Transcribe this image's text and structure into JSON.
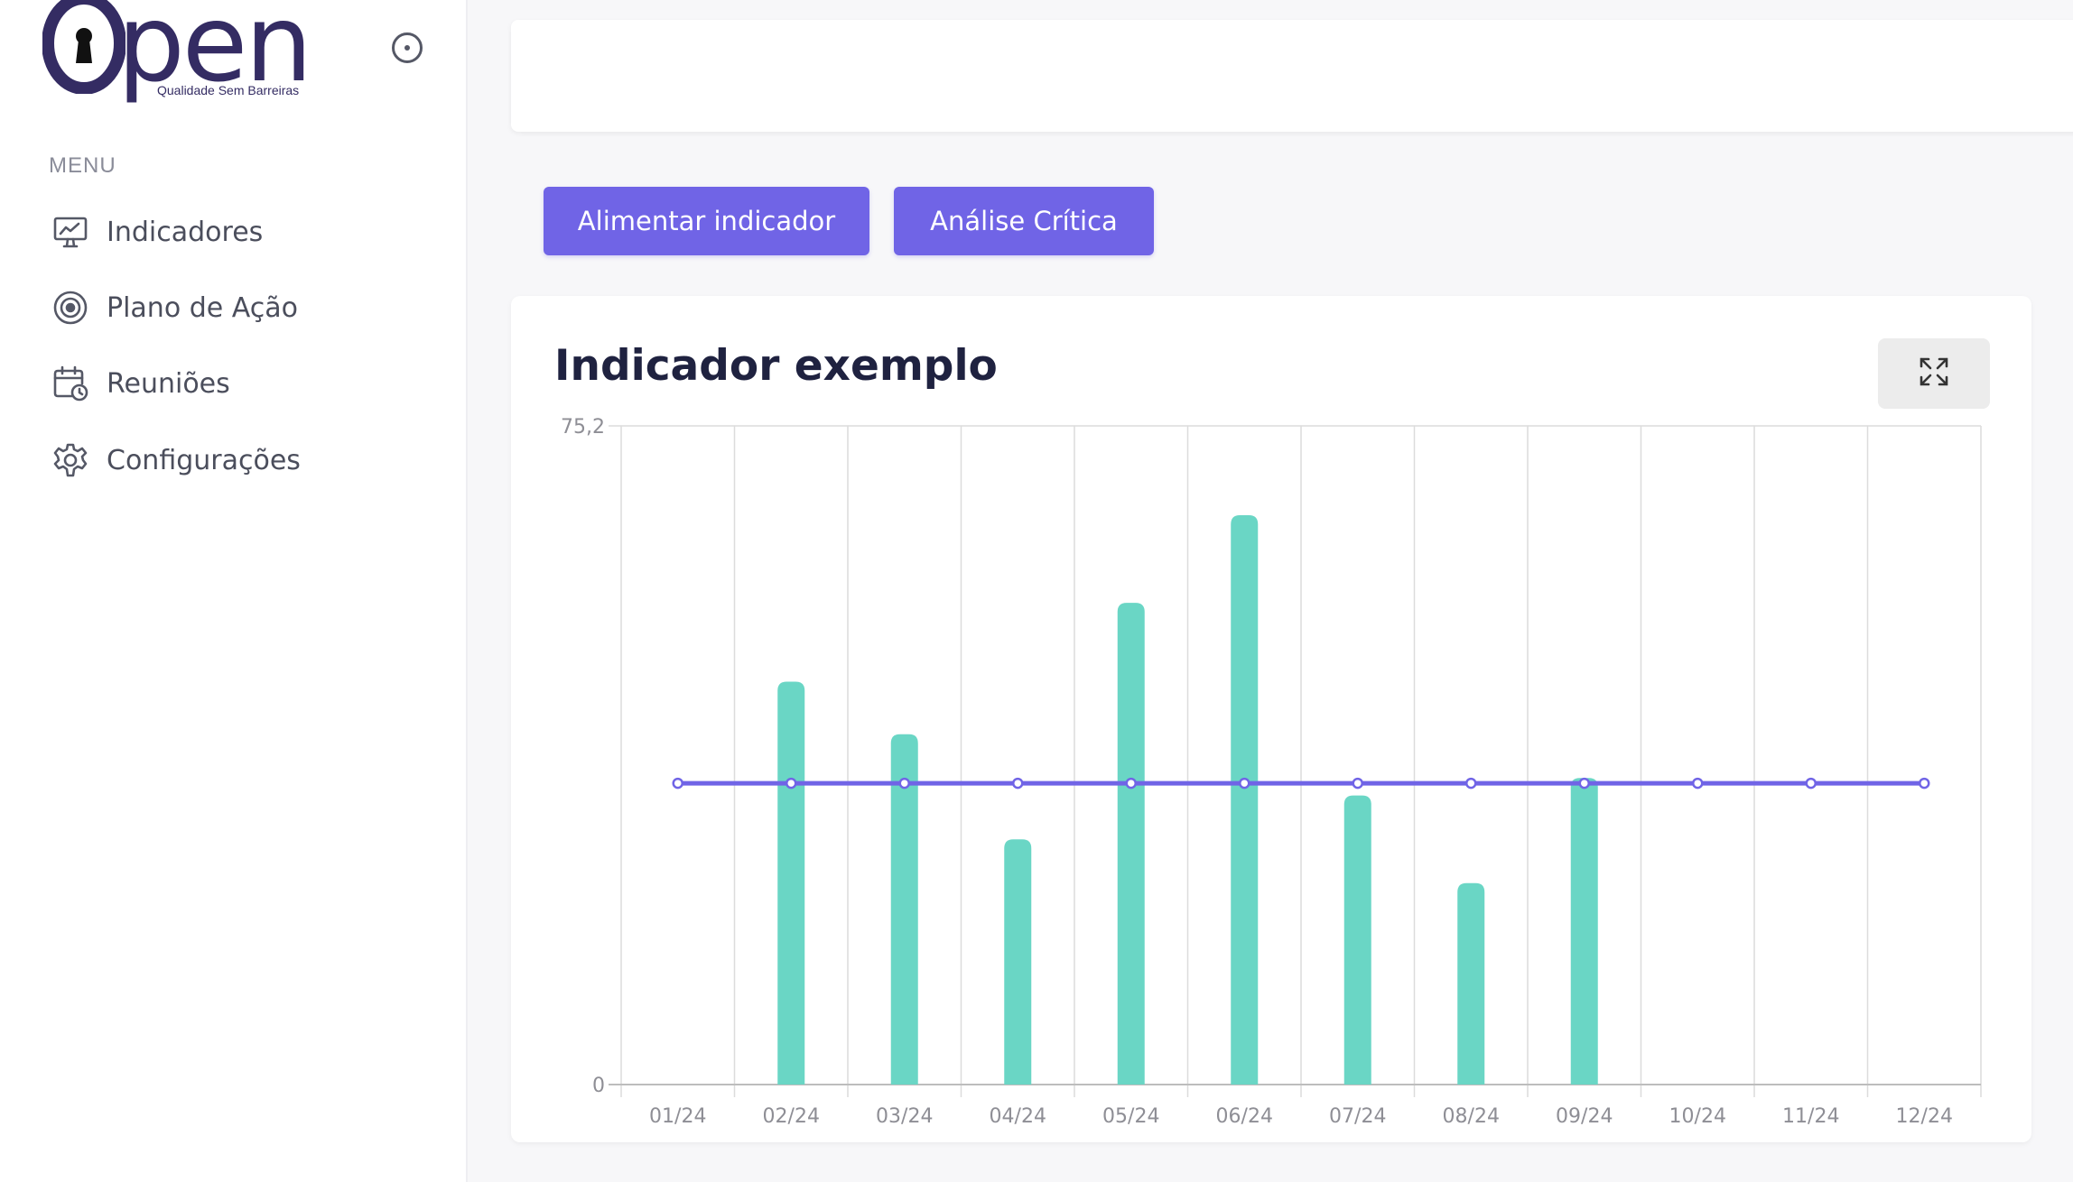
{
  "sidebar": {
    "logo": {
      "word": "Open",
      "tagline": "Qualidade Sem Barreiras"
    },
    "menu_heading": "MENU",
    "items": [
      {
        "label": "Indicadores",
        "icon": "monitor-chart-icon"
      },
      {
        "label": "Plano de Ação",
        "icon": "target-icon"
      },
      {
        "label": "Reuniões",
        "icon": "calendar-clock-icon"
      },
      {
        "label": "Configurações",
        "icon": "gear-icon"
      }
    ]
  },
  "actions": {
    "feed_label": "Alimentar indicador",
    "analysis_label": "Análise Crítica"
  },
  "colors": {
    "primary": "#7064e6",
    "bar": "#6ad6c5",
    "target_line": "#7064e6",
    "logo": "#342c63"
  },
  "card": {
    "title": "Indicador exemplo"
  },
  "chart_data": {
    "type": "bar",
    "title": "Indicador exemplo",
    "categories": [
      "01/24",
      "02/24",
      "03/24",
      "04/24",
      "05/24",
      "06/24",
      "07/24",
      "08/24",
      "09/24",
      "10/24",
      "11/24",
      "12/24"
    ],
    "series": [
      {
        "type": "bar",
        "values": [
          null,
          46,
          40,
          28,
          55,
          65,
          33,
          23,
          35,
          null,
          null,
          null
        ]
      },
      {
        "type": "line",
        "values": [
          34.4,
          34.4,
          34.4,
          34.4,
          34.4,
          34.4,
          34.4,
          34.4,
          34.4,
          34.4,
          34.4,
          34.4
        ]
      }
    ],
    "ylim": [
      0,
      75.2
    ],
    "y_ticks": [
      "0",
      "75,2"
    ],
    "grid": true
  }
}
